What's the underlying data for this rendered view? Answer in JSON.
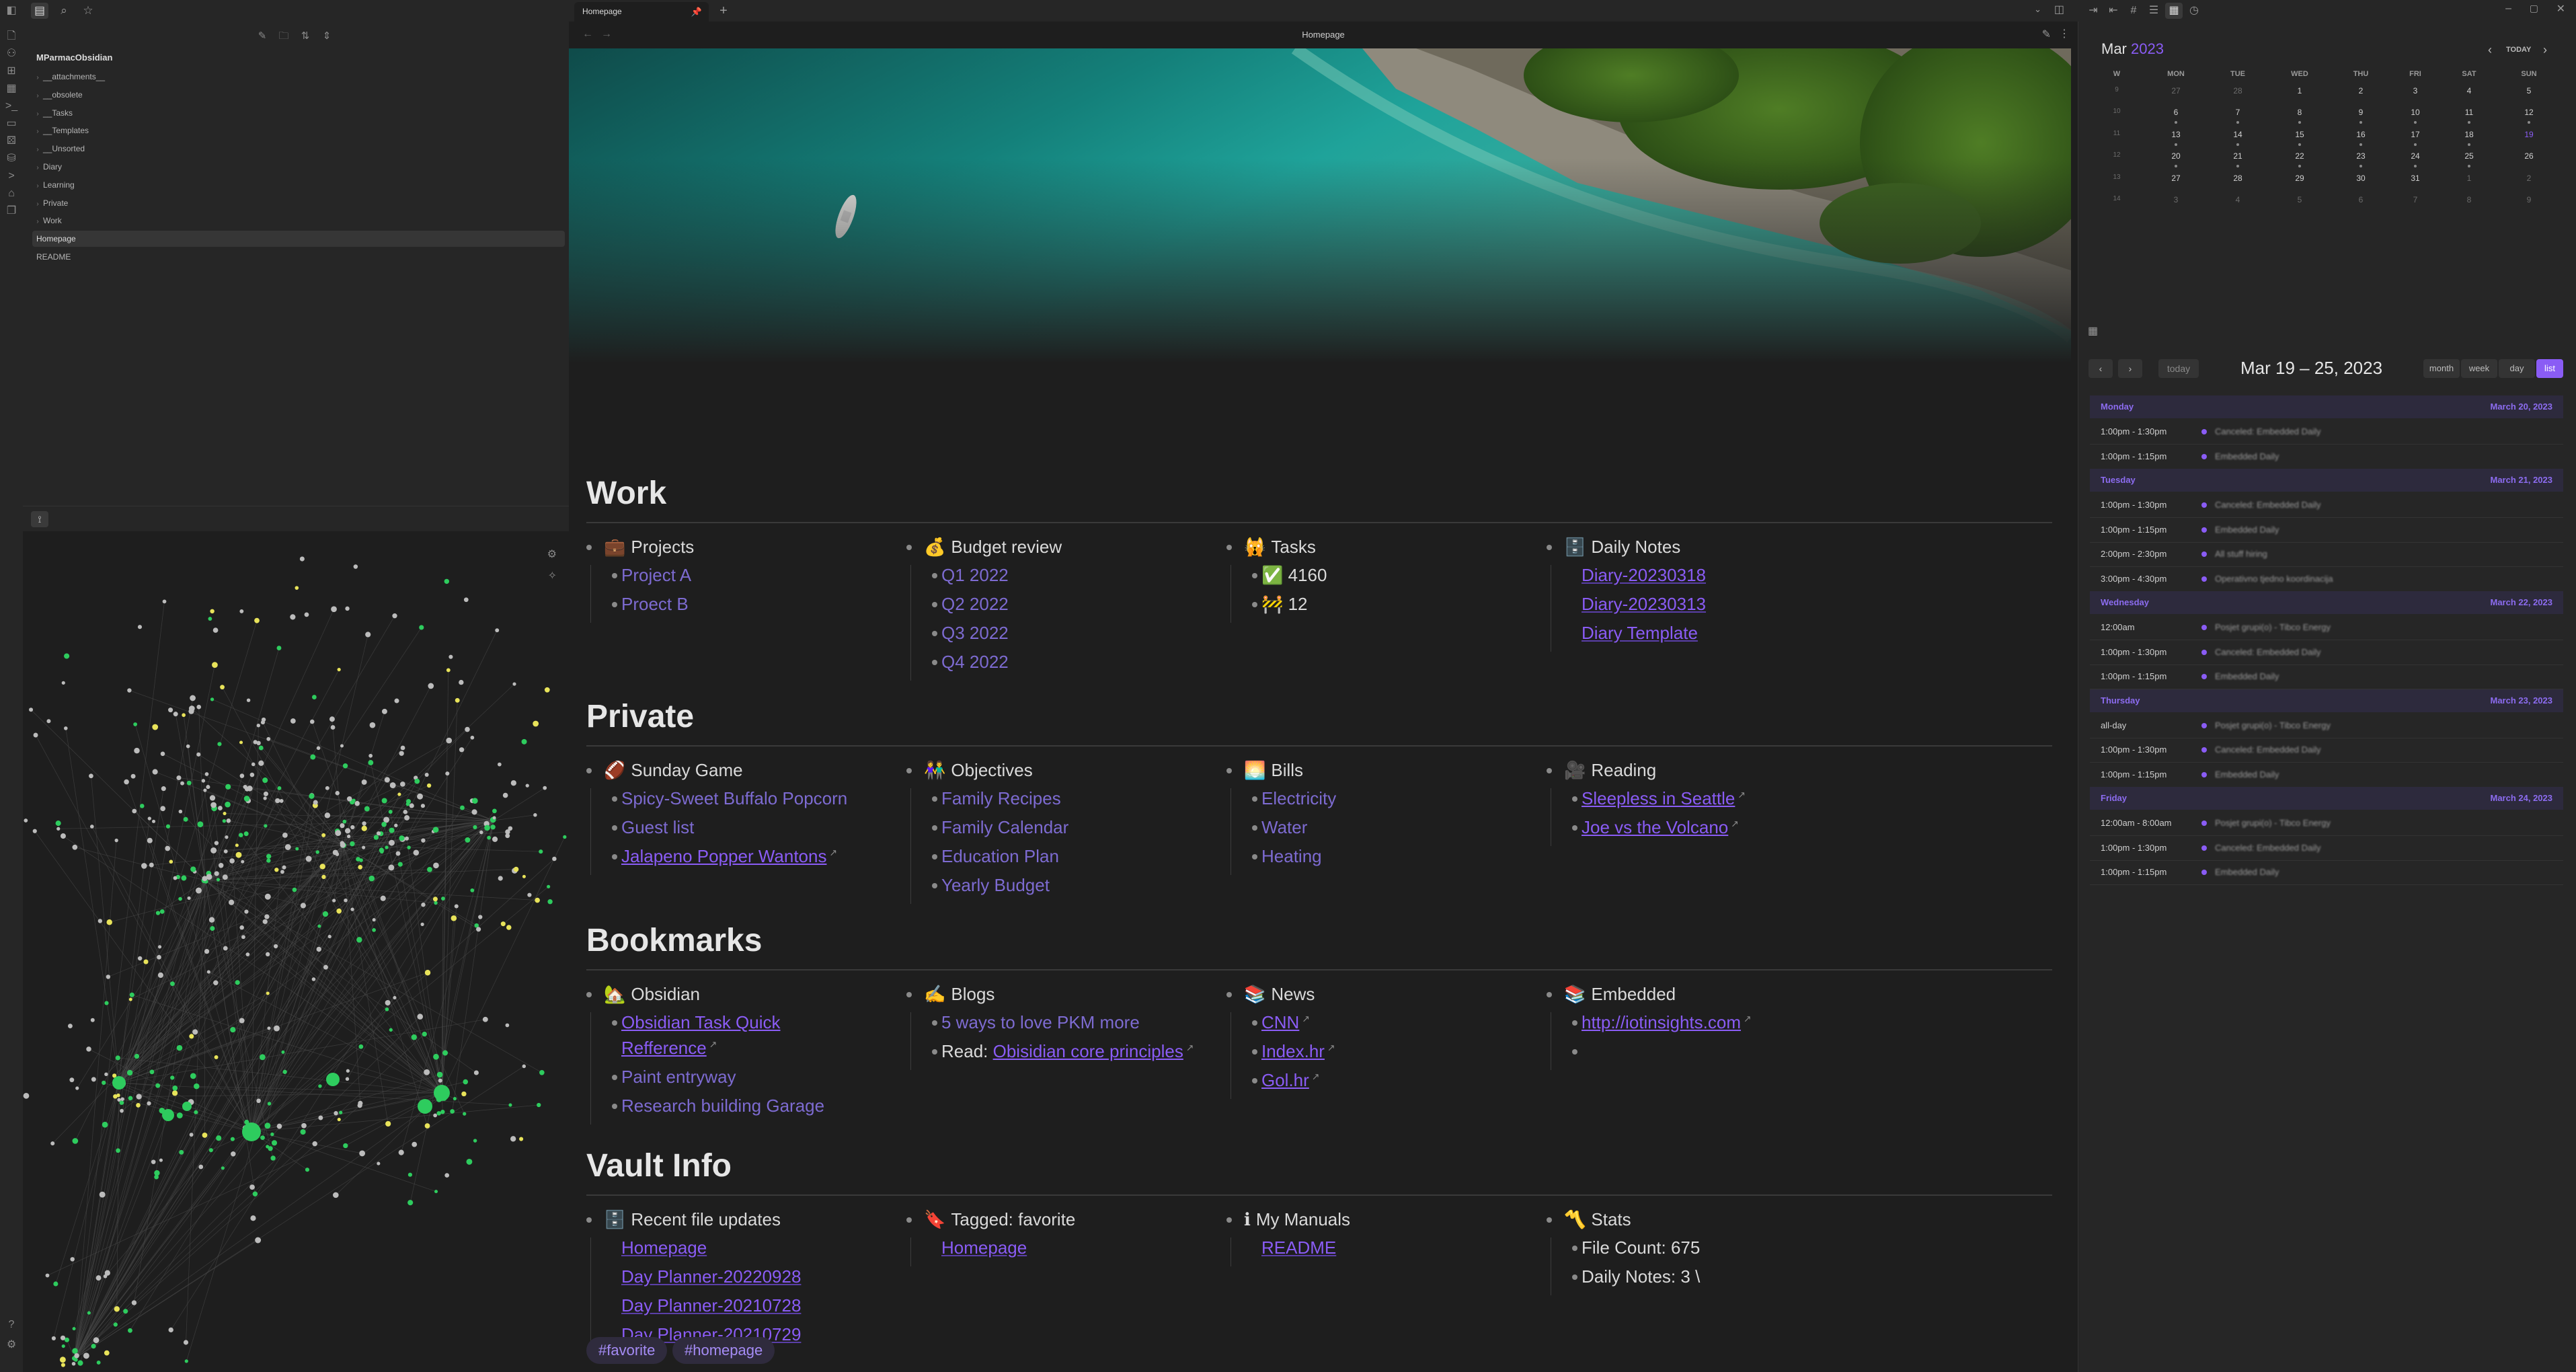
{
  "colors": {
    "accent": "#8a5cf5",
    "bg": "#1e1e1e",
    "sidebar": "#262626",
    "graph_node_green": "#2ecc5e",
    "graph_node_yellow": "#e8e35a",
    "graph_node_gray": "#bcbcbc"
  },
  "ribbon": {
    "icons": [
      "sidebar-toggle-icon",
      "file-icon",
      "graph-icon",
      "canvas-icon",
      "calendar-icon",
      "terminal-icon",
      "slides-icon",
      "dice-icon",
      "database-icon",
      "command-icon",
      "home-icon",
      "template-icon",
      "help-icon",
      "settings-icon"
    ]
  },
  "left": {
    "tabs": [
      "files-tab-icon",
      "search-tab-icon",
      "bookmarks-tab-icon"
    ],
    "file_actions": [
      "new-note-icon",
      "new-folder-icon",
      "sort-icon",
      "collapse-icon"
    ],
    "vault_name": "MParmacObsidian",
    "tree": [
      {
        "label": "__attachments__",
        "type": "folder"
      },
      {
        "label": "__obsolete",
        "type": "folder"
      },
      {
        "label": "__Tasks",
        "type": "folder"
      },
      {
        "label": "__Templates",
        "type": "folder"
      },
      {
        "label": "__Unsorted",
        "type": "folder"
      },
      {
        "label": "Diary",
        "type": "folder"
      },
      {
        "label": "Learning",
        "type": "folder"
      },
      {
        "label": "Private",
        "type": "folder"
      },
      {
        "label": "Work",
        "type": "folder"
      },
      {
        "label": "Homepage",
        "type": "file",
        "active": true
      },
      {
        "label": "README",
        "type": "file"
      }
    ],
    "graph_icons": [
      "graph-settings-icon",
      "graph-magic-icon"
    ]
  },
  "tabbar": {
    "tab_title": "Homepage",
    "new_tab": "+"
  },
  "view": {
    "title": "Homepage"
  },
  "note": {
    "sections": [
      {
        "title": "Work",
        "columns": [
          {
            "emoji": "💼",
            "head": "Projects",
            "items": [
              {
                "text": "Project A",
                "kind": "muted"
              },
              {
                "text": "Proect B",
                "kind": "muted"
              }
            ]
          },
          {
            "emoji": "💰",
            "head": "Budget review",
            "items": [
              {
                "text": "Q1 2022",
                "kind": "muted"
              },
              {
                "text": "Q2 2022",
                "kind": "muted"
              },
              {
                "text": "Q3 2022",
                "kind": "muted"
              },
              {
                "text": "Q4 2022",
                "kind": "muted"
              }
            ]
          },
          {
            "emoji": "🙀",
            "head": "Tasks",
            "items": [
              {
                "text": "✅ 4160",
                "kind": "plain"
              },
              {
                "text": "🚧 12",
                "kind": "plain"
              }
            ]
          },
          {
            "emoji": "🗄️",
            "head": "Daily Notes",
            "items": [
              {
                "text": "Diary-20230318",
                "kind": "link",
                "nobullet": true
              },
              {
                "text": "Diary-20230313",
                "kind": "link",
                "nobullet": true
              },
              {
                "text": "Diary Template",
                "kind": "link",
                "nobullet": true
              }
            ]
          }
        ]
      },
      {
        "title": "Private",
        "columns": [
          {
            "emoji": "🏈",
            "head": "Sunday Game",
            "items": [
              {
                "text": "Spicy-Sweet Buffalo Popcorn",
                "kind": "muted"
              },
              {
                "text": "Guest list",
                "kind": "muted"
              },
              {
                "text": "Jalapeno Popper Wantons",
                "kind": "ext"
              }
            ]
          },
          {
            "emoji": "👫",
            "head": "Objectives",
            "items": [
              {
                "text": "Family Recipes",
                "kind": "muted"
              },
              {
                "text": "Family Calendar",
                "kind": "muted"
              },
              {
                "text": "Education Plan",
                "kind": "muted"
              },
              {
                "text": "Yearly Budget",
                "kind": "muted"
              }
            ]
          },
          {
            "emoji": "🌅",
            "head": "Bills",
            "items": [
              {
                "text": "Electricity",
                "kind": "muted"
              },
              {
                "text": "Water",
                "kind": "muted"
              },
              {
                "text": "Heating",
                "kind": "muted"
              }
            ]
          },
          {
            "emoji": "🎥",
            "head": "Reading",
            "items": [
              {
                "text": "Sleepless in Seattle",
                "kind": "ext"
              },
              {
                "text": "Joe vs the Volcano",
                "kind": "ext"
              }
            ]
          }
        ]
      },
      {
        "title": "Bookmarks",
        "columns": [
          {
            "emoji": "🏡",
            "head": "Obsidian",
            "items": [
              {
                "text": "Obsidian Task Quick",
                "kind": "ext-wrap",
                "cont": "Refference"
              },
              {
                "text": "Paint entryway",
                "kind": "muted"
              },
              {
                "text": "Research building Garage",
                "kind": "muted"
              }
            ]
          },
          {
            "emoji": "✍️",
            "head": "Blogs",
            "items": [
              {
                "text": "5 ways to love PKM more",
                "kind": "muted"
              },
              {
                "prefix": "Read: ",
                "text": "Obisidian core principles",
                "kind": "ext"
              }
            ]
          },
          {
            "emoji": "📚",
            "head": "News",
            "items": [
              {
                "text": "CNN",
                "kind": "ext"
              },
              {
                "text": "Index.hr",
                "kind": "ext"
              },
              {
                "text": "Gol.hr",
                "kind": "ext"
              }
            ]
          },
          {
            "emoji": "📚",
            "head": "Embedded",
            "items": [
              {
                "text": "http://iotinsights.com",
                "kind": "ext"
              },
              {
                "text": "",
                "kind": "plain"
              }
            ]
          }
        ]
      },
      {
        "title": "Vault Info",
        "columns": [
          {
            "emoji": "🗄️",
            "head": "Recent file updates",
            "items": [
              {
                "text": "Homepage",
                "kind": "link",
                "nobullet": true
              },
              {
                "text": "Day Planner-20220928",
                "kind": "link",
                "nobullet": true
              },
              {
                "text": "Day Planner-20210728",
                "kind": "link",
                "nobullet": true
              },
              {
                "text": "Day Planner-20210729",
                "kind": "link",
                "nobullet": true
              }
            ]
          },
          {
            "emoji": "🔖",
            "head": "Tagged: favorite",
            "items": [
              {
                "text": "Homepage",
                "kind": "link",
                "nobullet": true
              }
            ]
          },
          {
            "emoji": "ℹ",
            "head": "My Manuals",
            "items": [
              {
                "text": "README",
                "kind": "link",
                "nobullet": true
              }
            ]
          },
          {
            "emoji": "〽️",
            "head": "Stats",
            "items": [
              {
                "text": "File Count: 675",
                "kind": "plain"
              },
              {
                "text": "Daily Notes: 3 \\",
                "kind": "plain"
              }
            ]
          }
        ]
      }
    ],
    "tags": [
      "#favorite",
      "#homepage"
    ]
  },
  "right": {
    "tab_icons": [
      "outgoing-links-icon",
      "backlinks-icon",
      "tags-icon",
      "outline-icon",
      "calendar-tab-icon",
      "clock-icon"
    ],
    "calendar": {
      "month": "Mar",
      "year": "2023",
      "today_label": "TODAY",
      "dow": [
        "W",
        "MON",
        "TUE",
        "WED",
        "THU",
        "FRI",
        "SAT",
        "SUN"
      ],
      "weeks": [
        {
          "wk": "9",
          "days": [
            "27",
            "28",
            "1",
            "2",
            "3",
            "4",
            "5"
          ]
        },
        {
          "wk": "10",
          "days": [
            "6",
            "7",
            "8",
            "9",
            "10",
            "11",
            "12"
          ]
        },
        {
          "wk": "11",
          "days": [
            "13",
            "14",
            "15",
            "16",
            "17",
            "18",
            "19"
          ]
        },
        {
          "wk": "12",
          "days": [
            "20",
            "21",
            "22",
            "23",
            "24",
            "25",
            "26"
          ]
        },
        {
          "wk": "13",
          "days": [
            "27",
            "28",
            "29",
            "30",
            "31",
            "1",
            "2"
          ]
        },
        {
          "wk": "14",
          "days": [
            "3",
            "4",
            "5",
            "6",
            "7",
            "8",
            "9"
          ]
        }
      ]
    },
    "agenda": {
      "today_btn": "today",
      "range": "Mar 19 – 25, 2023",
      "views": [
        "month",
        "week",
        "day",
        "list"
      ],
      "days": [
        {
          "name": "Monday",
          "date": "March 20, 2023",
          "events": [
            {
              "time": "1:00pm - 1:30pm",
              "title": "Canceled: Embedded Daily"
            },
            {
              "time": "1:00pm - 1:15pm",
              "title": "Embedded Daily"
            }
          ]
        },
        {
          "name": "Tuesday",
          "date": "March 21, 2023",
          "events": [
            {
              "time": "1:00pm - 1:30pm",
              "title": "Canceled: Embedded Daily"
            },
            {
              "time": "1:00pm - 1:15pm",
              "title": "Embedded Daily"
            },
            {
              "time": "2:00pm - 2:30pm",
              "title": "All stuff hiring"
            },
            {
              "time": "3:00pm - 4:30pm",
              "title": "Operativno tjedno koordinacija"
            }
          ]
        },
        {
          "name": "Wednesday",
          "date": "March 22, 2023",
          "events": [
            {
              "time": "12:00am",
              "title": "Posjet grupi(o) - Tibco Energy"
            },
            {
              "time": "1:00pm - 1:30pm",
              "title": "Canceled: Embedded Daily"
            },
            {
              "time": "1:00pm - 1:15pm",
              "title": "Embedded Daily"
            }
          ]
        },
        {
          "name": "Thursday",
          "date": "March 23, 2023",
          "events": [
            {
              "time": "all-day",
              "title": "Posjet grupi(o) - Tibco Energy"
            },
            {
              "time": "1:00pm - 1:30pm",
              "title": "Canceled: Embedded Daily"
            },
            {
              "time": "1:00pm - 1:15pm",
              "title": "Embedded Daily"
            }
          ]
        },
        {
          "name": "Friday",
          "date": "March 24, 2023",
          "events": [
            {
              "time": "12:00am - 8:00am",
              "title": "Posjet grupi(o) - Tibco Energy"
            },
            {
              "time": "1:00pm - 1:30pm",
              "title": "Canceled: Embedded Daily"
            },
            {
              "time": "1:00pm - 1:15pm",
              "title": "Embedded Daily"
            }
          ]
        }
      ]
    }
  }
}
